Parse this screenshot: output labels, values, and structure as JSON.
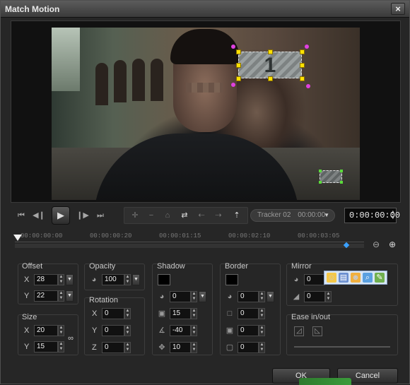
{
  "window": {
    "title": "Match Motion",
    "close_glyph": "×"
  },
  "preview": {
    "tracker_number": "1"
  },
  "transport": {
    "home_icon": "⏮",
    "prev_frame_icon": "◀❙",
    "play_icon": "▶",
    "next_frame_icon": "❙▶",
    "end_icon": "⏭",
    "tool_icons": [
      "✛",
      "−",
      "⌂",
      "⇄",
      "⇠",
      "⇢",
      "⇡"
    ],
    "tracker_select": "Tracker 02",
    "tracker_time": "00:00:00",
    "timecode": "0:00:00:00"
  },
  "ruler": {
    "ticks": [
      "00:00:00:00",
      "00:00:00:20",
      "00:00:01:15",
      "00:00:02:10",
      "00:00:03:05"
    ],
    "zoom_out_icon": "⊖",
    "zoom_in_icon": "⊕"
  },
  "offset": {
    "label": "Offset",
    "x_label": "X",
    "x": "28",
    "y_label": "Y",
    "y": "22"
  },
  "size": {
    "label": "Size",
    "x_label": "X",
    "x": "20",
    "y_label": "Y",
    "y": "15",
    "link_icon": "🔗"
  },
  "opacity": {
    "label": "Opacity",
    "value": "100"
  },
  "rotation": {
    "label": "Rotation",
    "x_label": "X",
    "x": "0",
    "y_label": "Y",
    "y": "0",
    "z_label": "Z",
    "z": "0"
  },
  "shadow": {
    "label": "Shadow",
    "opacity": "0",
    "blur": "15",
    "angle": "-40",
    "distance": "10",
    "color": "#000000"
  },
  "border": {
    "label": "Border",
    "opacity": "0",
    "width": "0",
    "blur": "0",
    "radius": "0",
    "color": "#000000"
  },
  "mirror": {
    "label": "Mirror",
    "opacity": "0",
    "distance": "0"
  },
  "ease": {
    "label": "Ease in/out"
  },
  "buttons": {
    "ok": "OK",
    "cancel": "Cancel"
  }
}
